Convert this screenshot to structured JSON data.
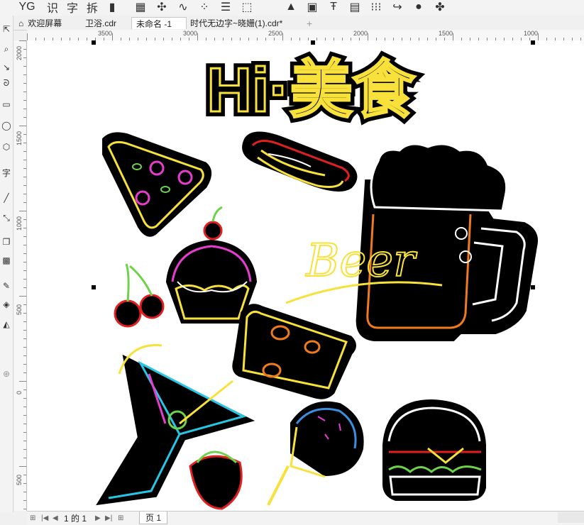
{
  "toolbar": {
    "items": [
      {
        "name": "yg-icon",
        "glyph": "YG"
      },
      {
        "name": "recognize-label",
        "glyph": "识"
      },
      {
        "name": "char-label",
        "glyph": "字"
      },
      {
        "name": "split-label",
        "glyph": "拆"
      },
      {
        "name": "page-icon",
        "glyph": "▮"
      },
      {
        "name": "table-icon",
        "glyph": "▦"
      },
      {
        "name": "pattern-icon",
        "glyph": "✣"
      },
      {
        "name": "curve-icon",
        "glyph": "∿"
      },
      {
        "name": "node-icon",
        "glyph": "⁘"
      },
      {
        "name": "align-icon",
        "glyph": "☰"
      },
      {
        "name": "frame-icon",
        "glyph": "⬚"
      },
      {
        "name": "shapes-icon",
        "glyph": "▲"
      },
      {
        "name": "image-icon",
        "glyph": "▣"
      },
      {
        "name": "text-frame-icon",
        "glyph": "Ŧ"
      },
      {
        "name": "grid-icon",
        "glyph": "▤"
      },
      {
        "name": "dots-icon",
        "glyph": "⁝⁝⁝"
      },
      {
        "name": "arrow-icon",
        "glyph": "↪"
      },
      {
        "name": "logo-icon",
        "glyph": "●"
      },
      {
        "name": "plugin-icon",
        "glyph": "✤"
      }
    ]
  },
  "tabs": [
    {
      "label": "欢迎屏幕",
      "active": false
    },
    {
      "label": "卫浴.cdr",
      "active": false
    },
    {
      "label": "未命名 -1",
      "active": true
    },
    {
      "label": "时代无边字~晓姗(1).cdr*",
      "active": false
    }
  ],
  "add_tab": "+",
  "ruler": {
    "h_labels": [
      "3500",
      "3000",
      "2500",
      "2000",
      "1500",
      "1000"
    ],
    "v_labels": [
      "2000",
      "1500",
      "1000",
      "500",
      "0",
      "500"
    ]
  },
  "artwork": {
    "title": "Hi·美食",
    "beer_text": "Beer"
  },
  "status": {
    "page_current": "1",
    "page_of": "的",
    "page_total": "1",
    "page_tab": "页 1"
  },
  "colors": {
    "yellow": "#f7e13a",
    "magenta": "#e83ccf",
    "cyan": "#27c6e5",
    "red": "#e02020",
    "orange": "#f07a1e",
    "green": "#6ed34a",
    "blue": "#3b8fe0",
    "white": "#ffffff"
  }
}
